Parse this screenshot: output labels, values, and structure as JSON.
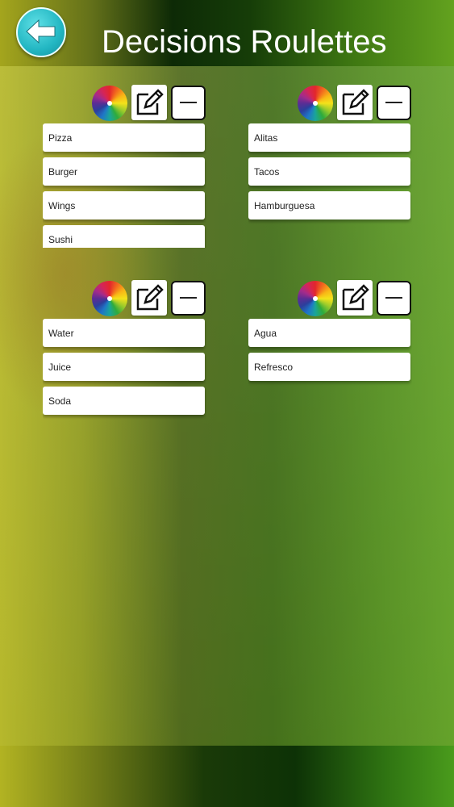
{
  "header": {
    "title": "Decisions Roulettes",
    "back_icon": "back-arrow-icon"
  },
  "colors": {
    "back_button": "#22b6c2",
    "title_text": "#ffffff",
    "item_background": "#ffffff"
  },
  "roulettes": [
    {
      "items": [
        "Pizza",
        "Burger",
        "Wings",
        "Sushi"
      ]
    },
    {
      "items": [
        "Alitas",
        "Tacos",
        "Hamburguesa"
      ]
    },
    {
      "items": [
        "Water",
        "Juice",
        "Soda"
      ]
    },
    {
      "items": [
        "Agua",
        "Refresco"
      ]
    }
  ],
  "icons": {
    "wheel": "color-wheel-icon",
    "edit": "edit-pencil-icon",
    "remove": "minus-icon"
  }
}
